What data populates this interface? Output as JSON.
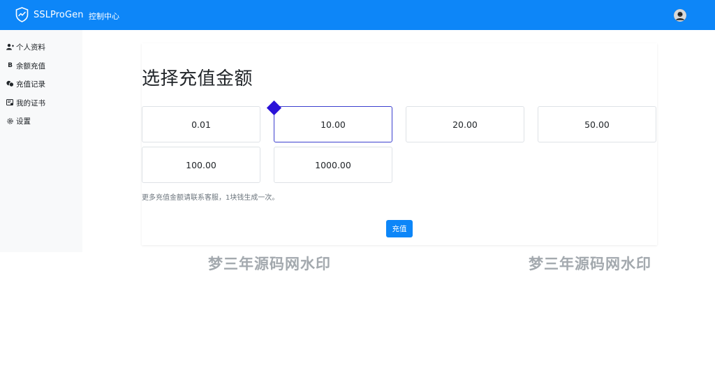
{
  "navbar": {
    "brand": "SSLProGen",
    "link": "控制中心",
    "brand_color": "#0d86f8"
  },
  "sidebar": {
    "items": [
      {
        "label": "个人资料",
        "icon": "user-add-icon"
      },
      {
        "label": "余额充值",
        "icon": "bitcoin-icon"
      },
      {
        "label": "充值记录",
        "icon": "coins-icon"
      },
      {
        "label": "我的证书",
        "icon": "certificate-icon"
      },
      {
        "label": "设置",
        "icon": "gear-icon"
      }
    ]
  },
  "main": {
    "title": "选择充值金额",
    "amounts": [
      "0.01",
      "10.00",
      "20.00",
      "50.00",
      "100.00",
      "1000.00"
    ],
    "selected_amount": "10.00",
    "hint": "更多充值金额请联系客服，1块钱生成一次。",
    "submit_label": "充值"
  },
  "watermark": {
    "left": "梦三年源码网水印",
    "right": "梦三年源码网水印"
  }
}
